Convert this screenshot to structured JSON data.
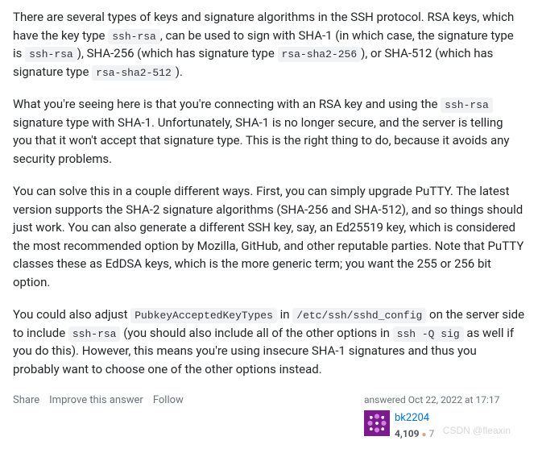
{
  "paragraphs": {
    "p1": {
      "t1": "There are several types of keys and signature algorithms in the SSH protocol. RSA keys, which have the key type ",
      "c1": "ssh-rsa",
      "t2": ", can be used to sign with SHA-1 (in which case, the signature type is ",
      "c2": "ssh-rsa",
      "t3": "), SHA-256 (which has signature type ",
      "c3": "rsa-sha2-256",
      "t4": "), or SHA-512 (which has signature type ",
      "c4": "rsa-sha2-512",
      "t5": ")."
    },
    "p2": {
      "t1": "What you're seeing here is that you're connecting with an RSA key and using the ",
      "c1": "ssh-rsa",
      "t2": " signature type with SHA-1. Unfortunately, SHA-1 is no longer secure, and the server is telling you that it won't accept that signature type. This is the right thing to do, because it avoids any security problems."
    },
    "p3": {
      "t1": "You can solve this in a couple different ways. First, you can simply upgrade PuTTY. The latest version supports the SHA-2 signature algorithms (SHA-256 and SHA-512), and so things should just work. You can also generate a different SSH key, say, an Ed25519 key, which is considered the most recommended option by Mozilla, GitHub, and other reputable parties. Note that PuTTY classes these as EdDSA keys, which is the more generic term; you want the 255 or 256 bit option."
    },
    "p4": {
      "t1": "You could also adjust ",
      "c1": "PubkeyAcceptedKeyTypes",
      "t2": " in ",
      "c2": "/etc/ssh/sshd_config",
      "t3": " on the server side to include ",
      "c3": "ssh-rsa",
      "t4": " (you should also include all of the other options in ",
      "c4": "ssh -Q sig",
      "t5": " as well if you do this). However, this means you're using insecure SHA-1 signatures and thus you probably want to choose one of the other options instead."
    }
  },
  "actions": {
    "share": "Share",
    "improve": "Improve this answer",
    "follow": "Follow"
  },
  "usercard": {
    "answered_prefix": "answered ",
    "answered_time": "Oct 22, 2022 at 17:17",
    "username": "bk2204",
    "reputation": "4,109",
    "bronze_count": "7"
  },
  "watermark": "CSDN @fleaxin"
}
